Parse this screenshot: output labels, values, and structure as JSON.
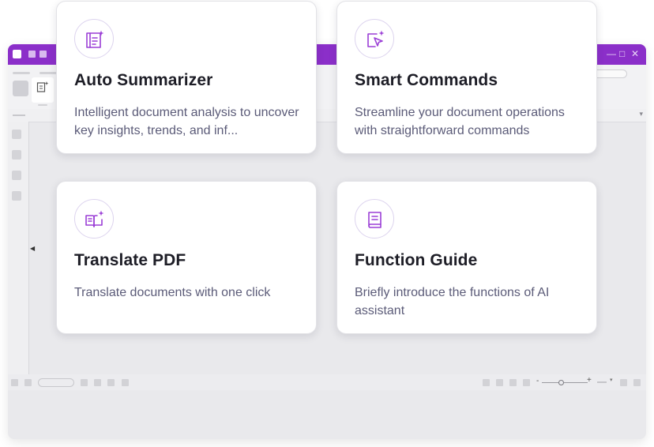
{
  "cards": [
    {
      "icon": "summarize-document-icon",
      "title": "Auto Summarizer",
      "description": "Intelligent document analysis to uncover key insights, trends, and inf..."
    },
    {
      "icon": "smart-cursor-icon",
      "title": "Smart Commands",
      "description": "Streamline your document operations with straightforward commands"
    },
    {
      "icon": "translate-book-icon",
      "title": "Translate PDF",
      "description": "Translate documents with one click"
    },
    {
      "icon": "guide-book-icon",
      "title": "Function Guide",
      "description": "Briefly introduce the functions of AI assistant"
    }
  ],
  "window": {
    "controls": {
      "minimize": "—",
      "maximize": "□",
      "close": "✕"
    },
    "zoom": {
      "minus": "-",
      "plus": "+"
    }
  },
  "colors": {
    "accent": "#8b2fc9",
    "icon_stroke": "#9b3fd6",
    "title_text": "#1d1d26",
    "description_text": "#5b5b78"
  }
}
